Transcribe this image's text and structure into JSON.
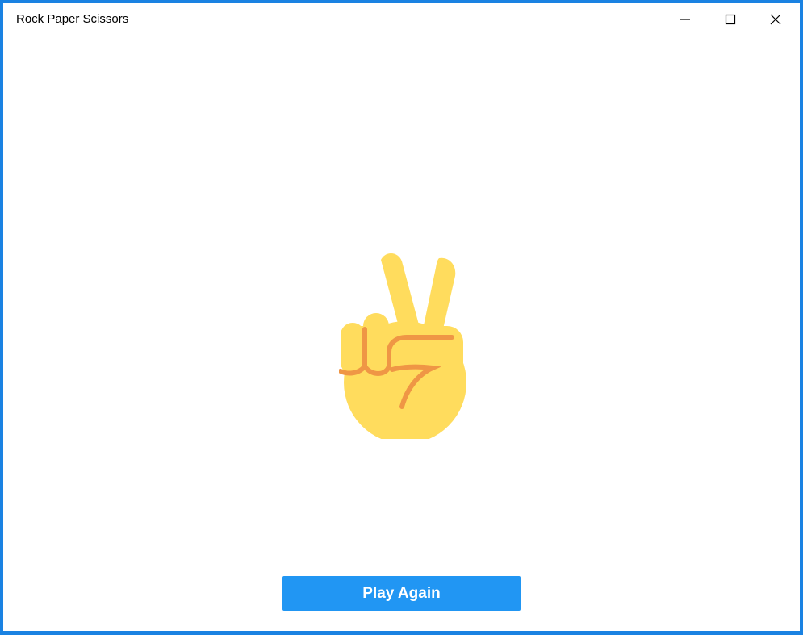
{
  "window": {
    "title": "Rock Paper Scissors",
    "controls": {
      "minimize_icon": "minimize-icon",
      "maximize_icon": "maximize-icon",
      "close_icon": "close-icon"
    }
  },
  "game": {
    "result_emoji": "victory-hand-icon",
    "emoji_color": "#FFDC5D",
    "emoji_line_color": "#EF9645"
  },
  "actions": {
    "play_again_label": "Play Again"
  },
  "colors": {
    "window_border": "#1A82E2",
    "button_bg": "#2196F3",
    "button_text": "#FFFFFF"
  }
}
